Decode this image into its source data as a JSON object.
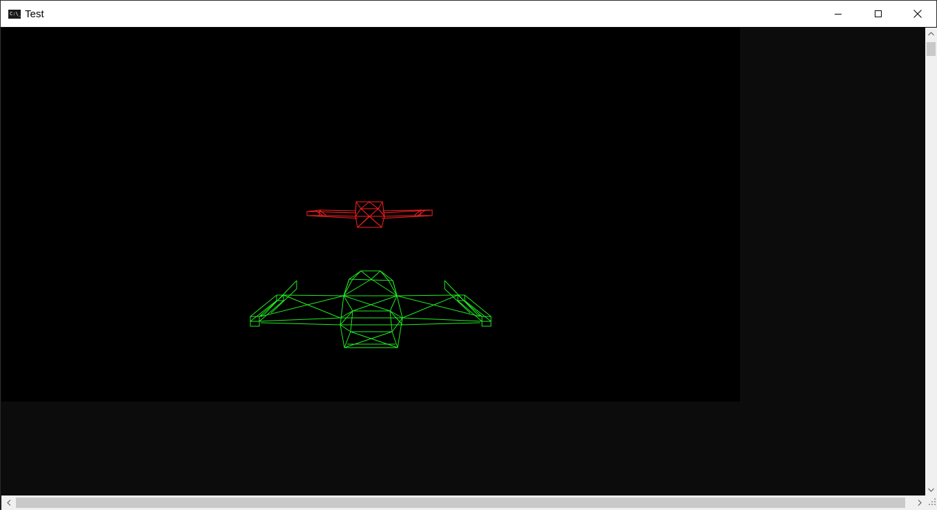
{
  "window": {
    "title": "Test",
    "app_icon": "console-icon",
    "app_icon_text": "C:\\_"
  },
  "controls": {
    "minimize_icon": "minimize-icon",
    "maximize_icon": "maximize-icon",
    "close_icon": "close-icon"
  },
  "scene": {
    "background": "#000000",
    "enemy_ship_color": "#ff2020",
    "player_ship_color": "#22ee22"
  },
  "colors": {
    "titlebar": "#ffffff",
    "console_background": "#0c0c0c",
    "scrollbar_track": "#f0f0f0",
    "scrollbar_thumb": "#c9c9c9"
  }
}
